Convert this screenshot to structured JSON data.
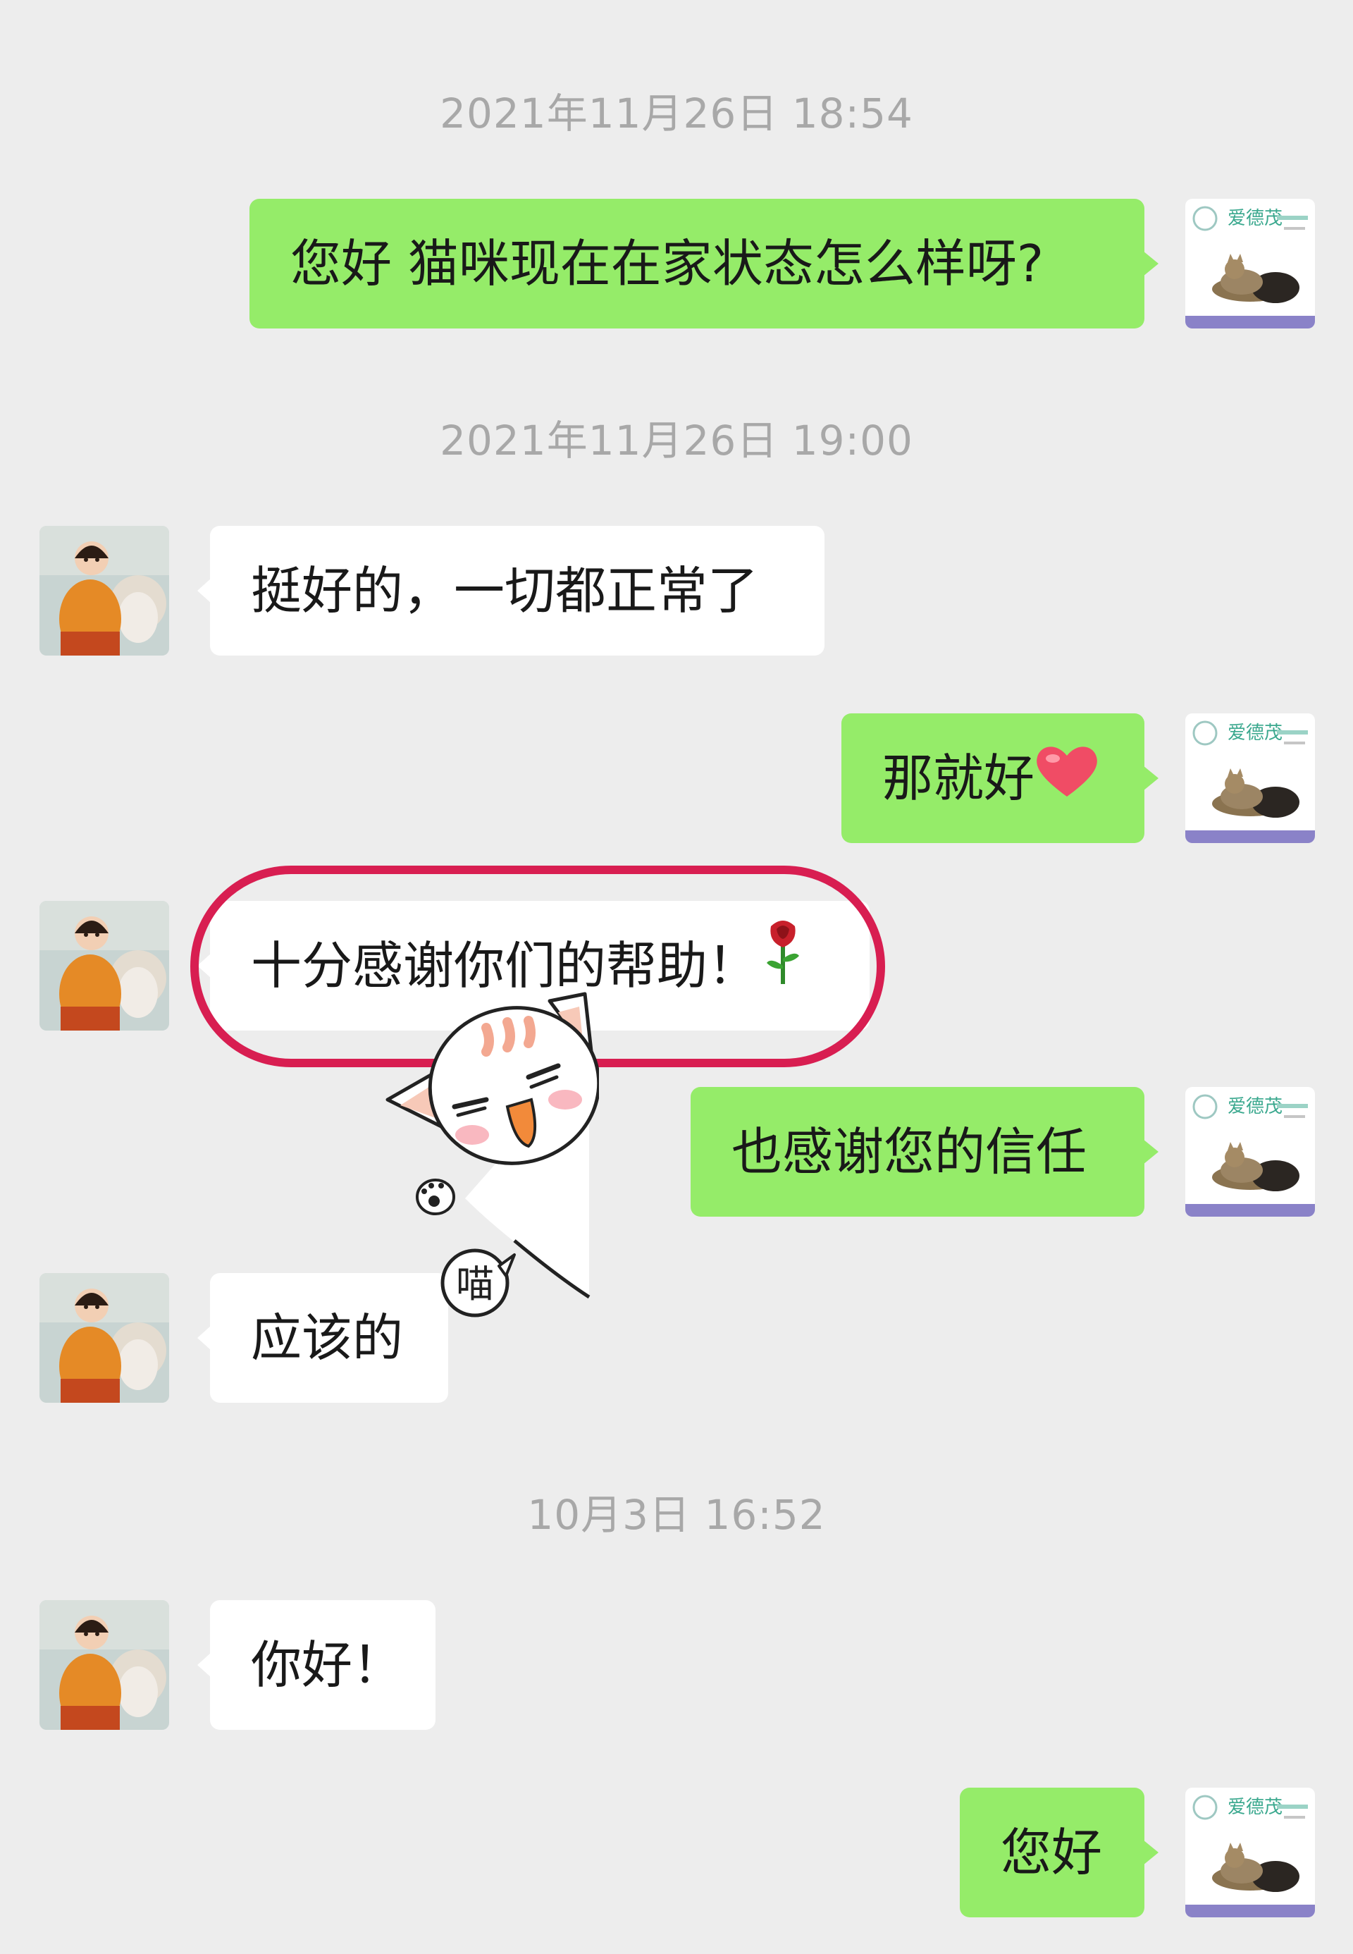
{
  "conversation": {
    "timestamps": [
      "2021年11月26日 18:54",
      "2021年11月26日 19:00",
      "10月3日 16:52"
    ],
    "messages": [
      {
        "from": "clinic",
        "text": "您好  猫咪现在在家状态怎么样呀?"
      },
      {
        "from": "customer",
        "text": "挺好的，一切都正常了"
      },
      {
        "from": "clinic",
        "text": "那就好",
        "emoji": "heart-emoji"
      },
      {
        "from": "customer",
        "text": "十分感谢你们的帮助！",
        "emoji": "rose-emoji",
        "highlighted": true
      },
      {
        "from": "clinic",
        "text": "也感谢您的信任"
      },
      {
        "from": "customer",
        "text": "应该的"
      },
      {
        "from": "customer",
        "text": "你好！"
      },
      {
        "from": "clinic",
        "text": "您好"
      }
    ]
  },
  "clinic_avatar": {
    "logo_text": "爱德茂",
    "icon": "pet-clinic-logo-with-cats"
  },
  "customer_avatar": {
    "icon": "child-photo"
  },
  "sticker": {
    "icon": "waving-cat-sticker",
    "speech_text": "喵"
  },
  "colors": {
    "background": "#ededed",
    "outgoing_bubble": "#95ec69",
    "incoming_bubble": "#ffffff",
    "timestamp_text": "#a8a8a8",
    "highlight_ring": "#d81e51"
  }
}
